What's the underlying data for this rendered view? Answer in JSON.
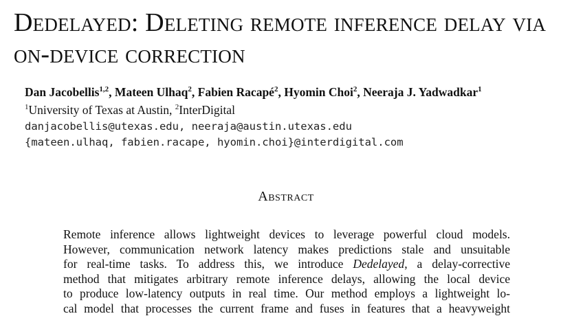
{
  "paper": {
    "title": "Dedelayed: Deleting remote inference delay via on-device correction",
    "authors": [
      {
        "name": "Dan Jacobellis",
        "sup": "1,2",
        "sep": ", "
      },
      {
        "name": "Mateen Ulhaq",
        "sup": "2",
        "sep": ", "
      },
      {
        "name": "Fabien Racapé",
        "sup": "2",
        "sep": ", "
      },
      {
        "name": "Hyomin Choi",
        "sup": "2",
        "sep": ", "
      },
      {
        "name": "Neeraja J. Yadwadkar",
        "sup": "1",
        "sep": ""
      }
    ],
    "affiliations": {
      "sup1": "1",
      "aff1": "University of Texas at Austin, ",
      "sup2": "2",
      "aff2": "InterDigital"
    },
    "emails": [
      "danjacobellis@utexas.edu, neeraja@austin.utexas.edu",
      "{mateen.ulhaq, fabien.racape, hyomin.choi}@interdigital.com"
    ],
    "abstract_heading": "Abstract",
    "abstract_lines": [
      {
        "pre": "Remote inference allows lightweight devices to leverage powerful cloud models.",
        "emph": "",
        "post": ""
      },
      {
        "pre": "However, communication network latency makes predictions stale and unsuitable",
        "emph": "",
        "post": ""
      },
      {
        "pre": "for real-time tasks.  To address this, we introduce ",
        "emph": "Dedelayed",
        "post": ", a delay-corrective"
      },
      {
        "pre": "method that mitigates arbitrary remote inference delays, allowing the local device",
        "emph": "",
        "post": ""
      },
      {
        "pre": "to produce low-latency outputs in real time.  Our method employs a lightweight lo-",
        "emph": "",
        "post": ""
      },
      {
        "pre": "cal model that processes the current frame and fuses in features that a heavyweight",
        "emph": "",
        "post": ""
      }
    ]
  }
}
